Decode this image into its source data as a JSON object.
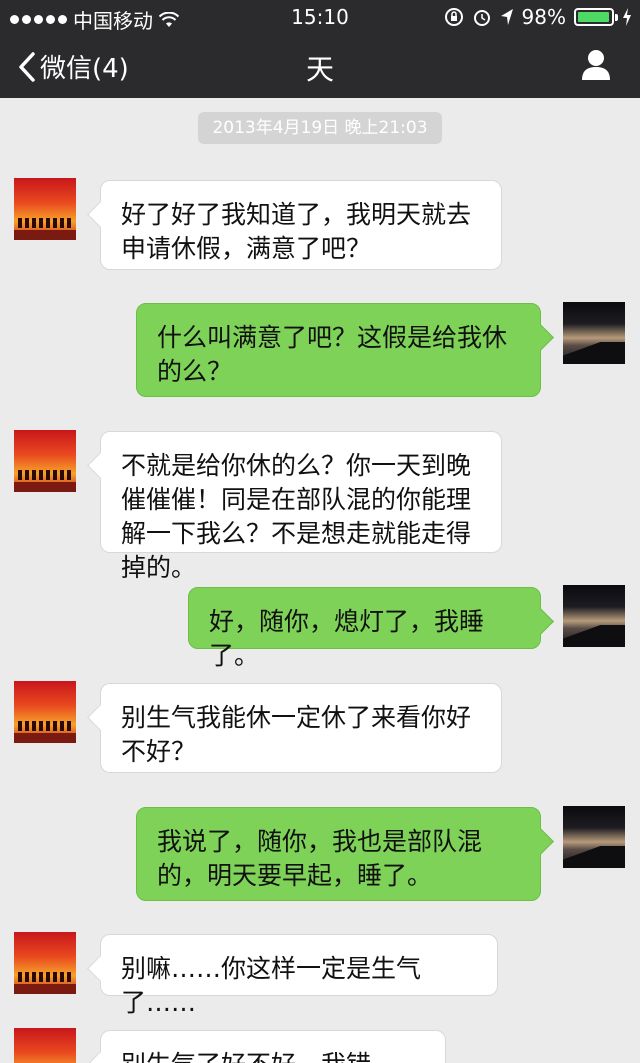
{
  "status_bar": {
    "carrier": "中国移动",
    "time": "15:10",
    "battery": "98%",
    "battery_level": 0.98
  },
  "nav": {
    "back_label": "微信(4)",
    "title": "天"
  },
  "timestamp": "2013年4月19日  晚上21:03",
  "messages": [
    {
      "side": "left",
      "text": "好了好了我知道了，我明天就去申请休假，满意了吧？",
      "avatar": "red-sunset-avatar"
    },
    {
      "side": "right",
      "text": "什么叫满意了吧？这假是给我休的么？",
      "avatar": "dusk-landscape-avatar"
    },
    {
      "side": "left",
      "text": "不就是给你休的么？你一天到晚催催催！同是在部队混的你能理解一下我么？不是想走就能走得掉的。",
      "avatar": "red-sunset-avatar"
    },
    {
      "side": "right",
      "text": "好，随你，熄灯了，我睡了。",
      "avatar": "dusk-landscape-avatar"
    },
    {
      "side": "left",
      "text": "别生气我能休一定休了来看你好不好？",
      "avatar": "red-sunset-avatar"
    },
    {
      "side": "right",
      "text": "我说了，随你，我也是部队混的，明天要早起，睡了。",
      "avatar": "dusk-landscape-avatar"
    },
    {
      "side": "left",
      "text": "别嘛……你这样一定是生气了……",
      "avatar": "red-sunset-avatar"
    },
    {
      "side": "left",
      "text": "别生气了好不好，我错了……",
      "avatar": "red-sunset-avatar"
    }
  ]
}
